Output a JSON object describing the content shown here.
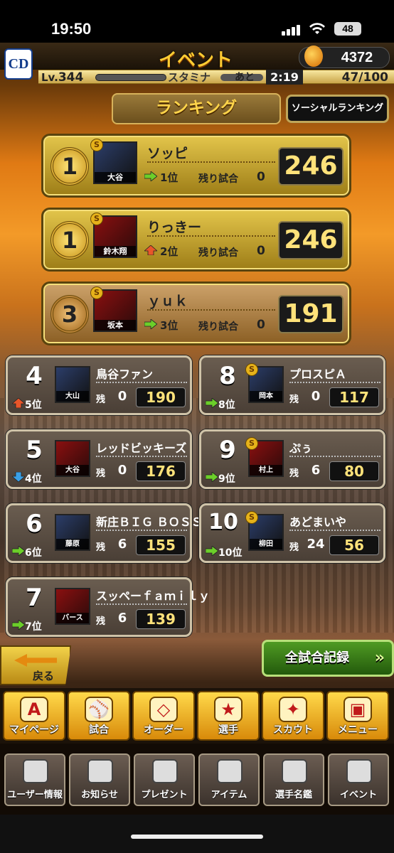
{
  "status": {
    "time": "19:50",
    "battery": "48"
  },
  "header": {
    "title": "イベント",
    "coins": "4372",
    "logo": "CD"
  },
  "infobar": {
    "lv_label": "Lv.",
    "lv": "344",
    "stamina_label": "スタミナ",
    "ato": "あと",
    "timer": "2:19",
    "stamina": "47/100"
  },
  "tabs": {
    "ranking": "ランキング",
    "social": "ソーシャルランキング"
  },
  "top": [
    {
      "rank": "1",
      "name": "ソッピ",
      "player": "大谷",
      "prev": "1位",
      "trend": "same",
      "remain_label": "残り試合",
      "remain": "0",
      "score": "246"
    },
    {
      "rank": "1",
      "name": "りっきー",
      "player": "鈴木翔",
      "prev": "2位",
      "trend": "up",
      "remain_label": "残り試合",
      "remain": "0",
      "score": "246"
    },
    {
      "rank": "3",
      "name": "ｙｕｋ",
      "player": "坂本",
      "prev": "3位",
      "trend": "same",
      "remain_label": "残り試合",
      "remain": "0",
      "score": "191"
    }
  ],
  "left": [
    {
      "rank": "4",
      "name": "鳥谷ファン",
      "player": "大山",
      "prev": "5位",
      "trend": "up",
      "remain_label": "残",
      "remain": "0",
      "score": "190"
    },
    {
      "rank": "5",
      "name": "レッドビッキーズ",
      "player": "大谷",
      "prev": "4位",
      "trend": "down",
      "remain_label": "残",
      "remain": "0",
      "score": "176"
    },
    {
      "rank": "6",
      "name": "新庄ＢＩＧ ＢＯＳＳ",
      "player": "藤原",
      "prev": "6位",
      "trend": "same",
      "remain_label": "残",
      "remain": "6",
      "score": "155"
    },
    {
      "rank": "7",
      "name": "スッペーｆａｍｉｌｙ",
      "player": "バース",
      "prev": "7位",
      "trend": "same",
      "remain_label": "残",
      "remain": "6",
      "score": "139"
    }
  ],
  "right": [
    {
      "rank": "8",
      "name": "プロスピＡ",
      "player": "岡本",
      "prev": "8位",
      "trend": "same",
      "remain_label": "残",
      "remain": "0",
      "score": "117"
    },
    {
      "rank": "9",
      "name": "ぷぅ",
      "player": "村上",
      "prev": "9位",
      "trend": "same",
      "remain_label": "残",
      "remain": "6",
      "score": "80"
    },
    {
      "rank": "10",
      "name": "あどまいや",
      "player": "柳田",
      "prev": "10位",
      "trend": "same",
      "remain_label": "残",
      "remain": "24",
      "score": "56"
    }
  ],
  "buttons": {
    "back": "戻る",
    "all_records": "全試合記録"
  },
  "nav1": [
    "マイページ",
    "試合",
    "オーダー",
    "選手",
    "スカウト",
    "メニュー"
  ],
  "nav2": [
    "ユーザー情報",
    "お知らせ",
    "プレゼント",
    "アイテム",
    "選手名鑑",
    "イベント"
  ],
  "colors": {
    "up": "#e8562a",
    "down": "#3aa0e6",
    "same": "#6ccf2a"
  }
}
